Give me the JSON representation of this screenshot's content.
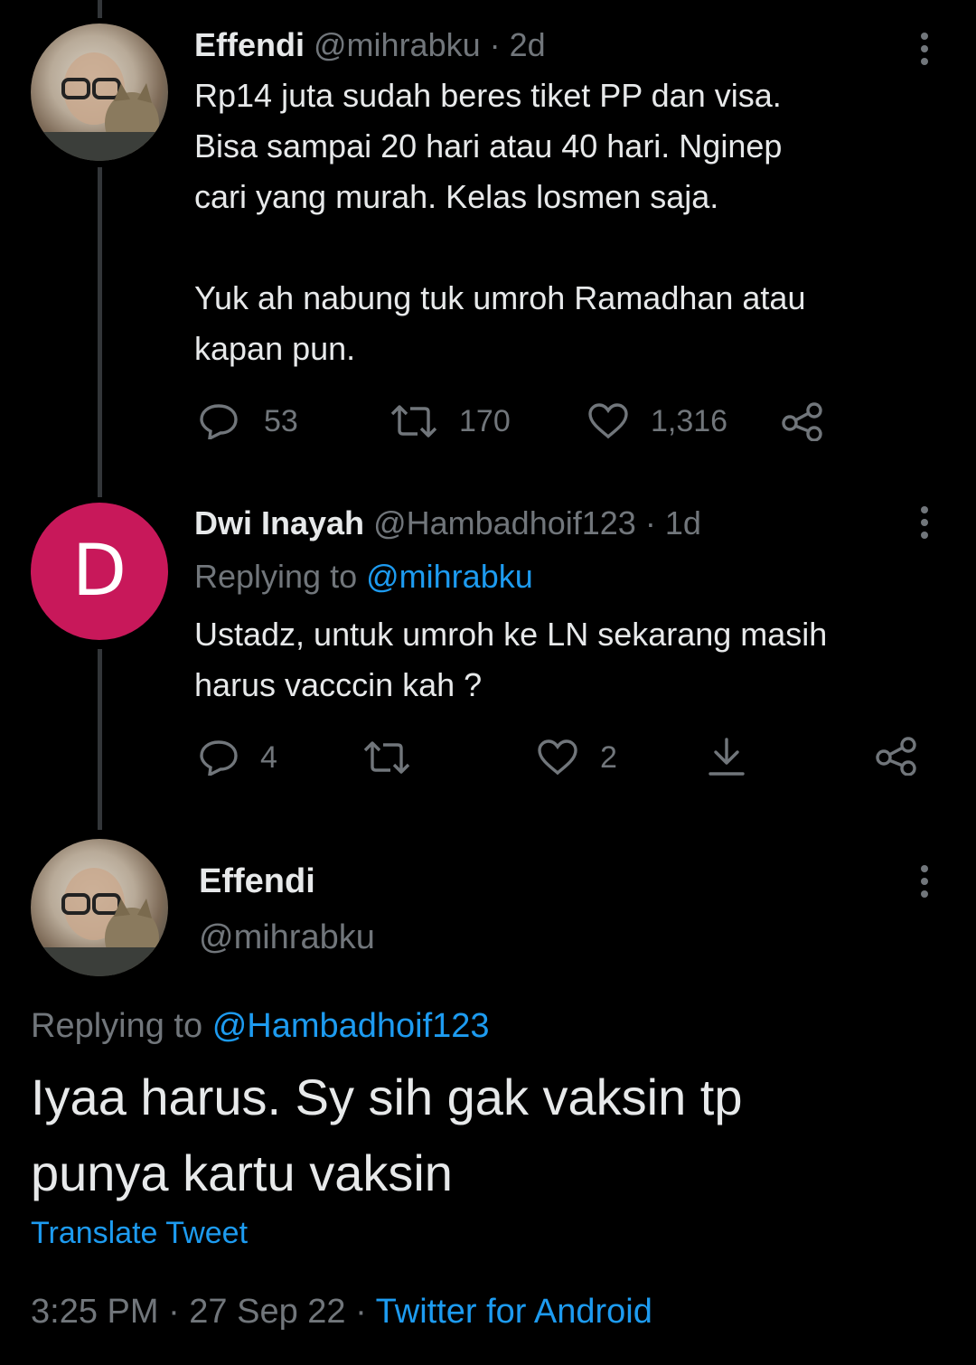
{
  "tweet1": {
    "name": "Effendi",
    "handle": "@mihrabku",
    "time": "· 2d",
    "text": "Rp14 juta sudah beres tiket PP dan visa.\nBisa sampai 20 hari atau 40 hari. Nginep\ncari yang murah. Kelas losmen saja.\n\nYuk ah nabung tuk umroh Ramadhan atau\nkapan pun.",
    "replies": "53",
    "retweets": "170",
    "likes": "1,316"
  },
  "tweet2": {
    "avatar_letter": "D",
    "avatar_color": "#c8185a",
    "name": "Dwi Inayah",
    "handle": "@Hambadhoif123",
    "time": "· 1d",
    "replying_prefix": "Replying to",
    "replying_to": "@mihrabku",
    "text": "Ustadz, untuk umroh ke LN sekarang masih\nharus vacccin kah ?",
    "replies": "4",
    "likes": "2"
  },
  "main_tweet": {
    "name": "Effendi",
    "handle": "@mihrabku",
    "replying_prefix": "Replying to",
    "replying_to": "@Hambadhoif123",
    "text": "Iyaa harus. Sy sih gak vaksin tp\npunya kartu vaksin",
    "translate": "Translate Tweet",
    "timestamp": "3:25 PM · 27 Sep 22 ·",
    "source": "Twitter for Android"
  },
  "colors": {
    "background": "#000000",
    "text": "#e7e9ea",
    "muted": "#71767b",
    "link": "#1d9bf0",
    "thread_line": "#333639"
  },
  "icons": [
    "reply-icon",
    "retweet-icon",
    "like-icon",
    "share-icon",
    "download-icon",
    "more-icon"
  ]
}
